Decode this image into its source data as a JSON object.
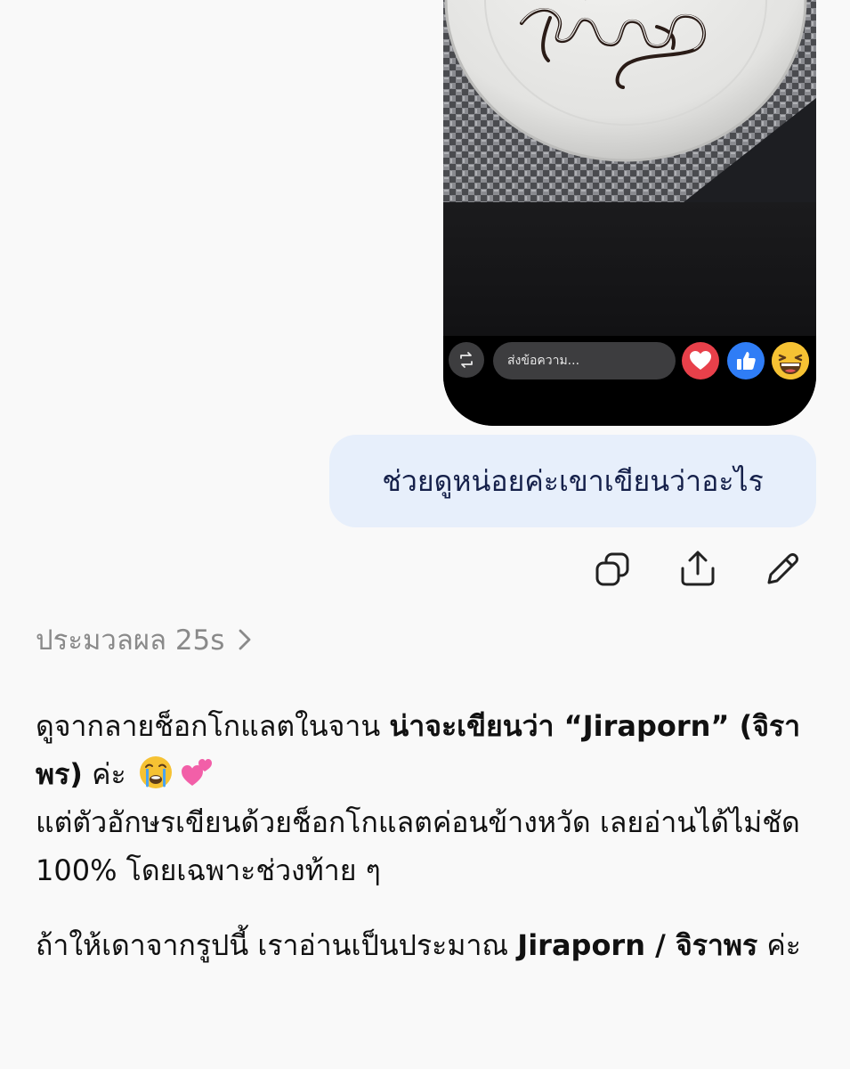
{
  "story_card": {
    "reply_placeholder": "ส่งข้อความ...",
    "reactions": [
      "heart-icon",
      "thumbs-up-icon",
      "grinning-squint-face-icon"
    ]
  },
  "user_message": {
    "text": "ช่วยดูหน่อยค่ะเขาเขียนว่าอะไร",
    "actions": [
      "copy-icon",
      "share-icon",
      "pencil-icon"
    ]
  },
  "assistant": {
    "thinking_label": "ประมวลผล 25s",
    "p1_a": "ดูจากลายช็อกโกแลตในจาน ",
    "p1_b": "น่าจะเขียนว่า “Jiraporn” (จิราพร)",
    "p1_c": " ค่ะ",
    "p1_d": "แต่ตัวอักษรเขียนด้วยช็อกโกแลตค่อนข้างหวัด เลยอ่านได้ไม่ชัด 100% โดยเฉพาะช่วงท้าย ๆ",
    "p2_a": "ถ้าให้เดาจากรูปนี้ เราอ่านเป็นประมาณ ",
    "p2_b": "Jiraporn / จิราพร",
    "p2_c": " ค่ะ",
    "emojis": [
      "loudly-crying-face-icon",
      "two-hearts-icon"
    ]
  },
  "colors": {
    "background": "#f9f9f9",
    "user_bubble": "#e7effb",
    "user_text": "#15204a",
    "muted_text": "#8a8a8a"
  }
}
